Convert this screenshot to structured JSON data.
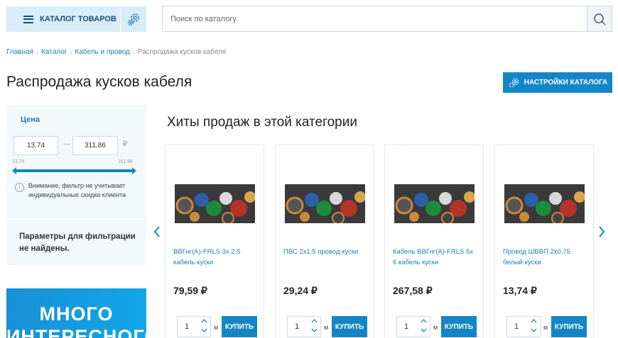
{
  "header": {
    "catalog_label": "КАТАЛОГ ТОВАРОВ",
    "search_placeholder": "Поиск по каталогу"
  },
  "breadcrumb": [
    "Главная",
    "Каталог",
    "Кабель и провод",
    "Распродажа кусков кабеля"
  ],
  "page_title": "Распродажа кусков кабеля",
  "settings_button": "НАСТРОЙКИ КАТАЛОГА",
  "filter": {
    "title": "Цена",
    "price_from": "13.74",
    "price_to": "311.86",
    "currency": "₽",
    "range_min": "13.74",
    "range_max": "311.86",
    "warning": "Внимание, фильтр не учитывает индивидуальные скидки клиента",
    "not_found": "Параметры для фильтрации не найдены."
  },
  "banner": {
    "text": "МНОГО ИНТЕРЕСНОГО"
  },
  "hits": {
    "title": "Хиты продаж в этой категории",
    "products": [
      {
        "name": "ВВГнг(А)-FRLS 3х 2,5 кабель куски",
        "price": "79,59 ₽",
        "qty": "1",
        "unit": "м",
        "buy": "КУПИТЬ"
      },
      {
        "name": "ПВС 2х1,5 провод куски",
        "price": "29,24 ₽",
        "qty": "1",
        "unit": "м",
        "buy": "КУПИТЬ"
      },
      {
        "name": "Кабель ВВГнг(А)-FRLS 5х 6 кабель куски",
        "price": "267,58 ₽",
        "qty": "1",
        "unit": "м",
        "buy": "КУПИТЬ"
      },
      {
        "name": "Провод ШВВП 2х0,75 белый куски",
        "price": "13,74 ₽",
        "qty": "1",
        "unit": "м",
        "buy": "КУПИТЬ"
      }
    ]
  },
  "colors": {
    "accent": "#1486c6",
    "link": "#1a7fb5",
    "panel": "#f3f8fb"
  }
}
